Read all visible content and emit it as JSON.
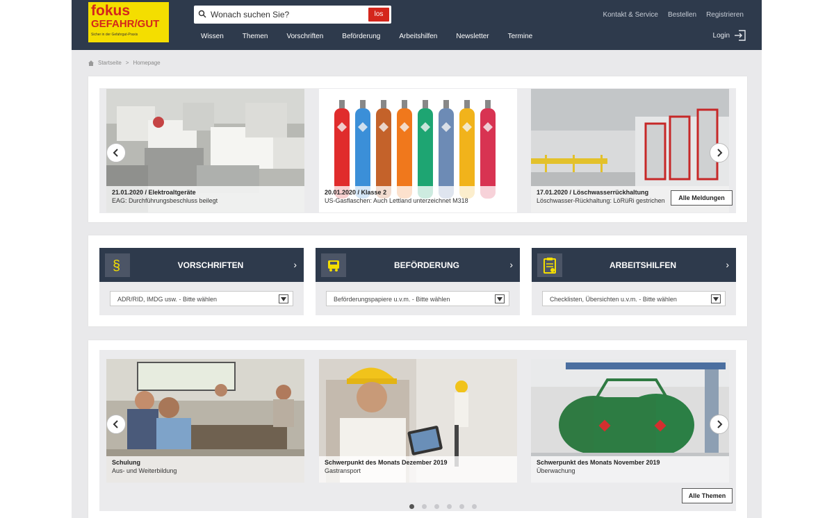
{
  "logo": {
    "line1": "fokus",
    "line2": "GEFAHR/GUT",
    "tagline": "Sicher in der Gefahrgut-Praxis"
  },
  "search": {
    "placeholder": "Wonach suchen Sie?",
    "button": "los"
  },
  "toplinks": [
    "Kontakt & Service",
    "Bestellen",
    "Registrieren"
  ],
  "nav": [
    "Wissen",
    "Themen",
    "Vorschriften",
    "Beförderung",
    "Arbeitshilfen",
    "Newsletter",
    "Termine"
  ],
  "login": "Login",
  "breadcrumb": {
    "home": "Startseite",
    "sep": ">",
    "current": "Homepage"
  },
  "news": {
    "items": [
      {
        "title": "21.01.2020 / Elektroaltgeräte",
        "subtitle": "EAG: Durchführungsbeschluss beilegt"
      },
      {
        "title": "20.01.2020 / Klasse 2",
        "subtitle": "US-Gasflaschen: Auch Lettland unterzeichnet M318"
      },
      {
        "title": "17.01.2020 / Löschwasserrückhaltung",
        "subtitle": "Löschwasser-Rückhaltung: LöRüRi gestrichen"
      }
    ],
    "all_button": "Alle Meldungen"
  },
  "categories": [
    {
      "label": "VORSCHRIFTEN",
      "select": "ADR/RID, IMDG usw. - Bitte wählen",
      "icon": "paragraph-icon"
    },
    {
      "label": "BEFÖRDERUNG",
      "select": "Beförderungspapiere u.v.m. - Bitte wählen",
      "icon": "truck-icon"
    },
    {
      "label": "ARBEITSHILFEN",
      "select": "Checklisten, Übersichten u.v.m. - Bitte wählen",
      "icon": "clipboard-icon"
    }
  ],
  "themes": {
    "items": [
      {
        "title": "Schulung",
        "subtitle": "Aus- und Weiterbildung"
      },
      {
        "title": "Schwerpunkt des Monats Dezember 2019",
        "subtitle": "Gastransport"
      },
      {
        "title": "Schwerpunkt des Monats November 2019",
        "subtitle": "Überwachung"
      }
    ],
    "all_button": "Alle Themen",
    "active_page": 1,
    "page_count": 6
  },
  "colors": {
    "header": "#2e3a4c",
    "accent": "#d4261c",
    "logo": "#f4de00"
  }
}
